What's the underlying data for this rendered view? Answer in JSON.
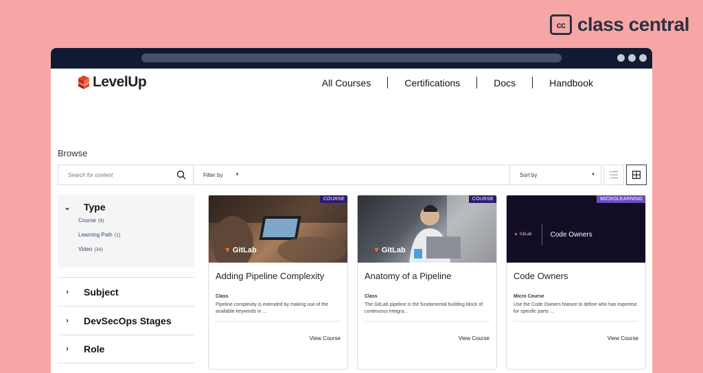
{
  "brand_cc": {
    "mark": "cc",
    "name": "class central"
  },
  "site": {
    "brand": "LevelUp",
    "nav": [
      "All Courses",
      "Certifications",
      "Docs",
      "Handbook"
    ]
  },
  "browse": {
    "title": "Browse",
    "search_placeholder": "Search for content",
    "filter_label": "Filter by",
    "sort_label": "Sort by"
  },
  "sidebar": {
    "type": {
      "label": "Type",
      "items": [
        {
          "label": "Course",
          "count": "(9)"
        },
        {
          "label": "Learning Path",
          "count": "(1)"
        },
        {
          "label": "Video",
          "count": "(34)"
        }
      ]
    },
    "facets": [
      "Subject",
      "DevSecOps Stages",
      "Role"
    ]
  },
  "cards": [
    {
      "badge": "COURSE",
      "watermark": "GitLab",
      "title": "Adding Pipeline Complexity",
      "type": "Class",
      "desc": "Pipeline complexity is extended by making use of the available keywords in ...",
      "link": "View Course"
    },
    {
      "badge": "COURSE",
      "watermark": "GitLab",
      "title": "Anatomy of a Pipeline",
      "type": "Class",
      "desc": "The GitLab pipeline is the fundamental building block of continuous integra...",
      "link": "View Course"
    },
    {
      "badge": "MICROLEARNING",
      "watermark": "GitLab",
      "image_title": "Code Owners",
      "title": "Code Owners",
      "type": "Micro Course",
      "desc": "Use the Code Owners feature to define who has expertise for specific parts ...",
      "link": "View Course"
    }
  ],
  "colors": {
    "background": "#f7a6a6",
    "window_bar": "#111a33",
    "badge": "#2d1b6e",
    "badge_micro": "#6b4fbf",
    "facet_link": "#2f4a73"
  }
}
